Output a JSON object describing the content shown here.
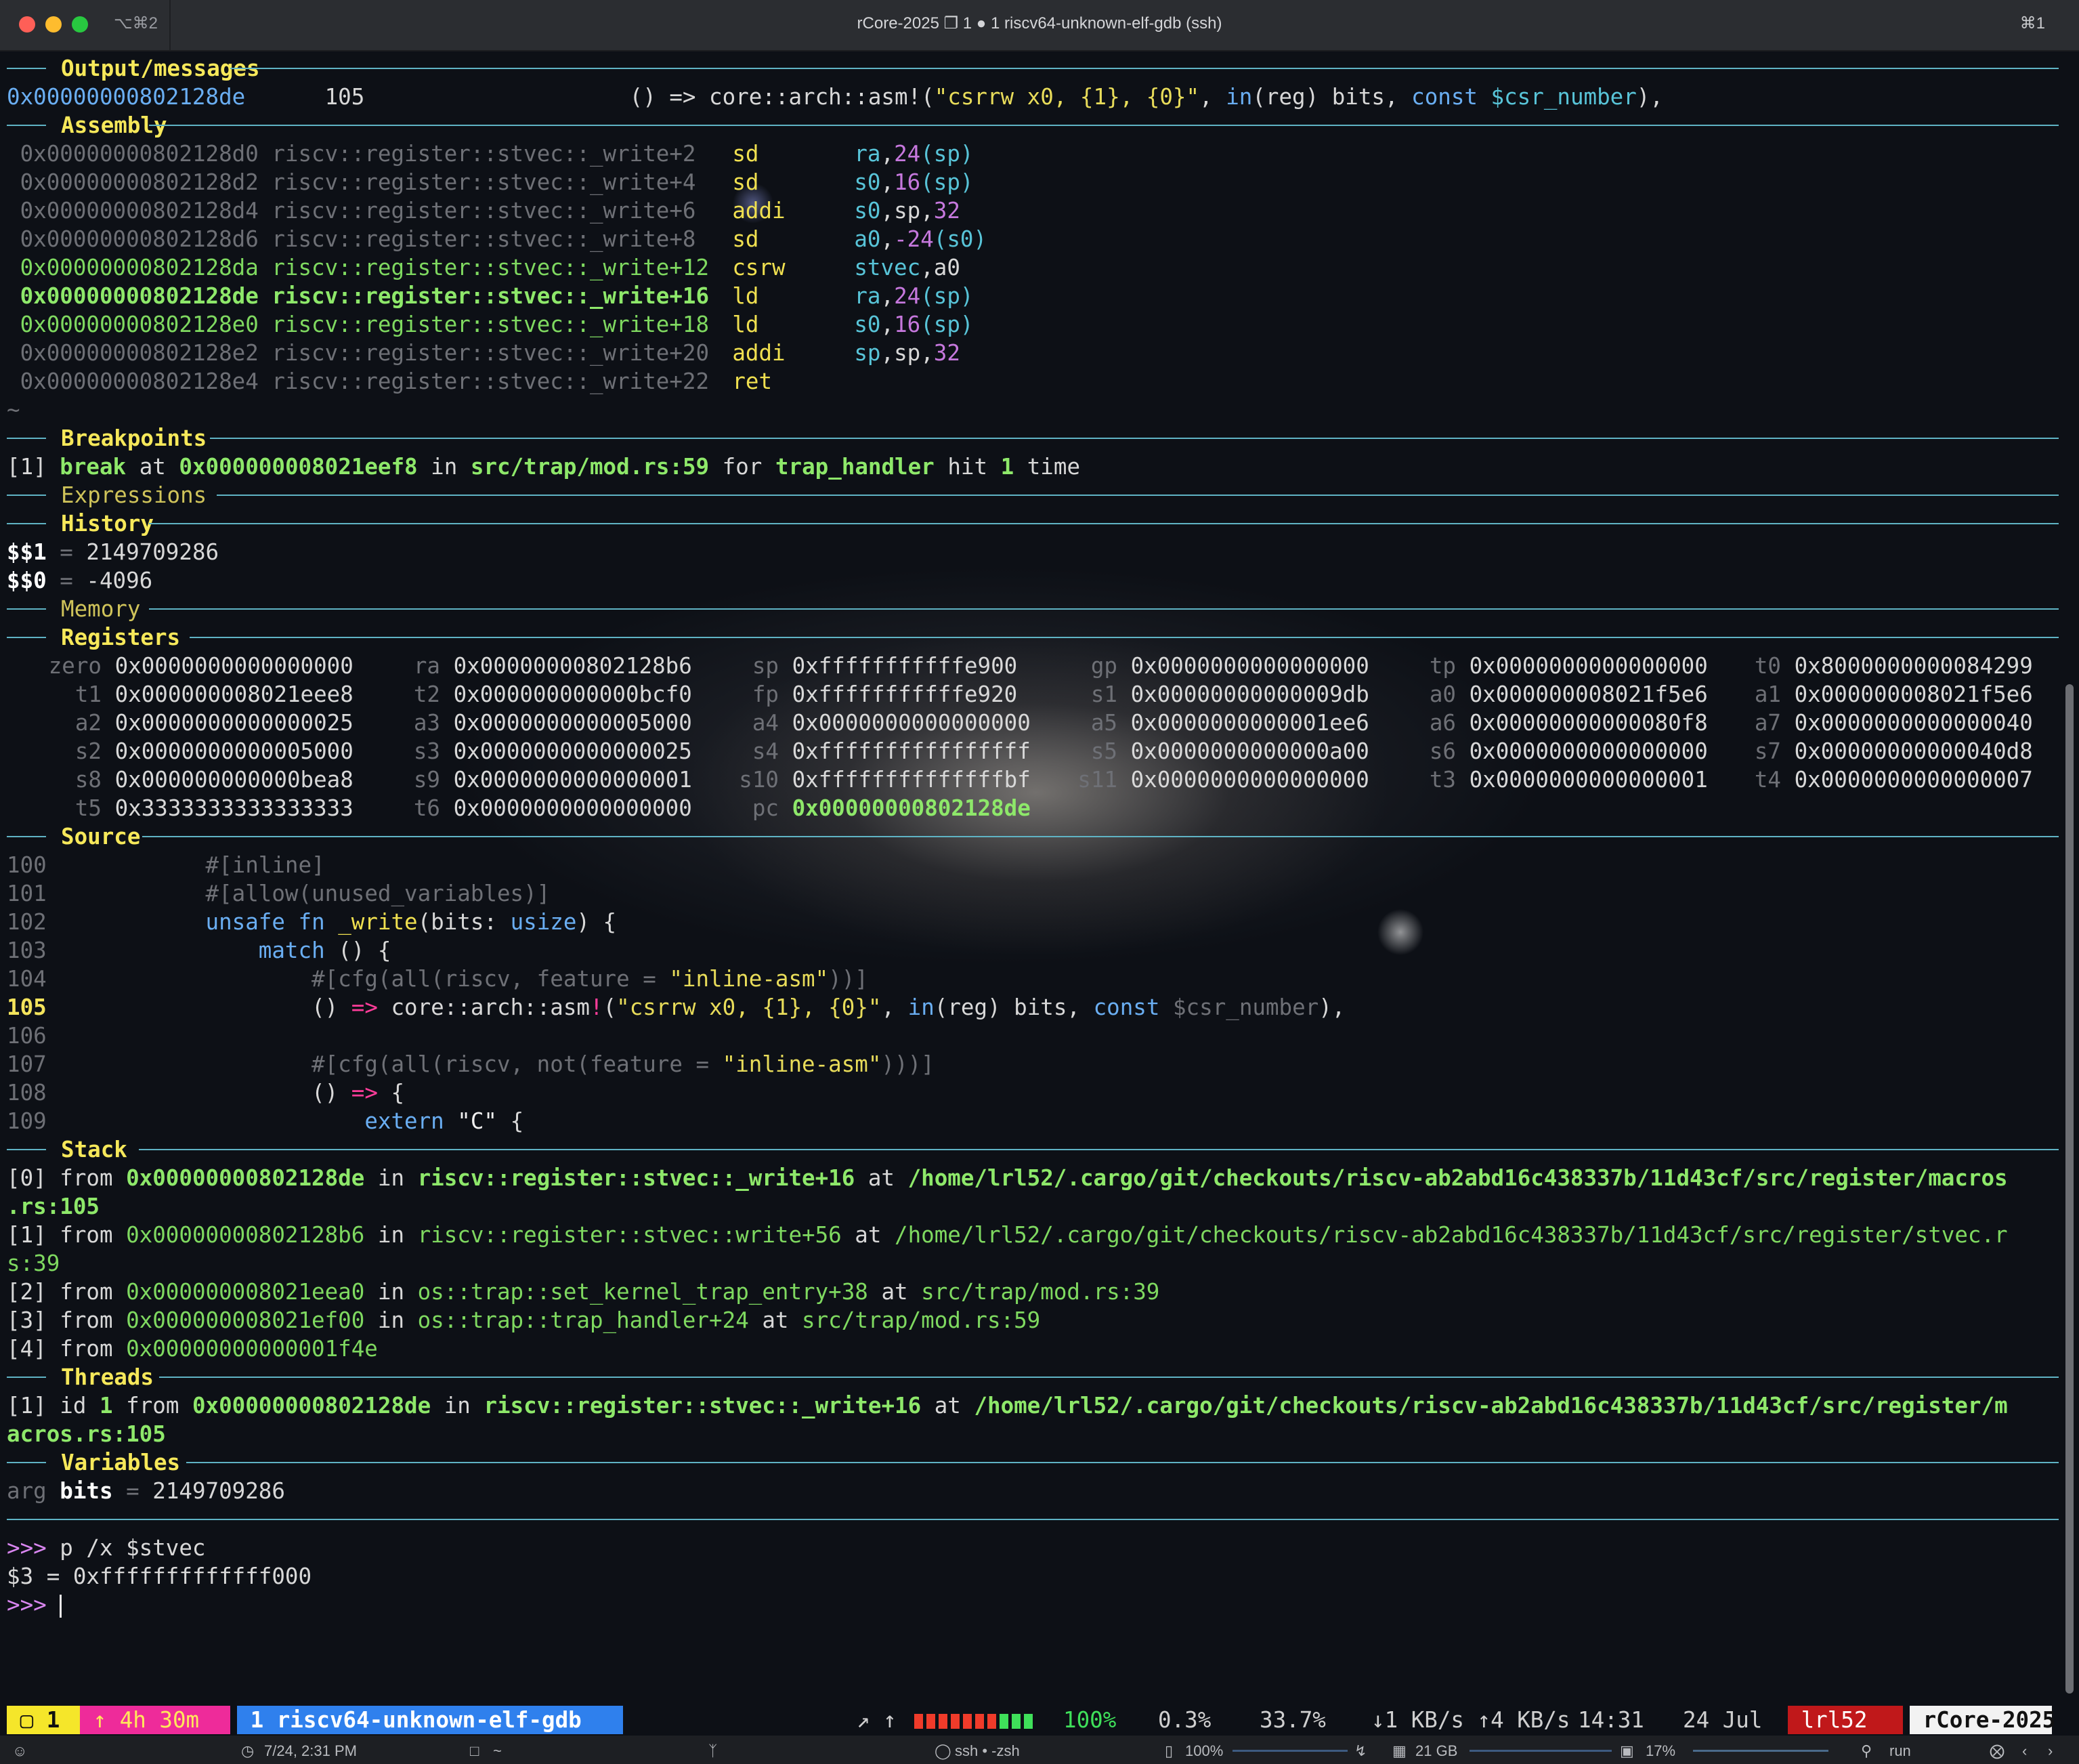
{
  "titlebar": {
    "shortcut_left": "⌥⌘2",
    "title": "rCore-2025 ❐ 1 ● 1 riscv64-unknown-elf-gdb (ssh)",
    "shortcut_right": "⌘1"
  },
  "output": {
    "title": "Output/messages",
    "address": "0x00000000802128de",
    "line_no": "105",
    "code_pre": "() => core::arch::asm!(",
    "code_str": "\"csrrw x0, {1}, {0}\"",
    "code_comma": ", ",
    "code_in": "in",
    "code_mid": "(reg) bits, ",
    "code_const": "const",
    "code_var": " $csr_number",
    "code_end": "),"
  },
  "assembly": {
    "title": "Assembly",
    "rows": [
      {
        "addr": "0x00000000802128d0",
        "sym": "riscv::register::stvec::_write+2",
        "op": "sd",
        "a1": "ra",
        "a2": ",",
        "a3": "24",
        "a4": "(sp)"
      },
      {
        "addr": "0x00000000802128d2",
        "sym": "riscv::register::stvec::_write+4",
        "op": "sd",
        "a1": "s0",
        "a2": ",",
        "a3": "16",
        "a4": "(sp)"
      },
      {
        "addr": "0x00000000802128d4",
        "sym": "riscv::register::stvec::_write+6",
        "op": "addi",
        "a1": "s0",
        "a2": ",sp,",
        "a3": "32",
        "a4": ""
      },
      {
        "addr": "0x00000000802128d6",
        "sym": "riscv::register::stvec::_write+8",
        "op": "sd",
        "a1": "a0",
        "a2": ",",
        "a3": "-24",
        "a4": "(s0)"
      },
      {
        "addr": "0x00000000802128da",
        "sym": "riscv::register::stvec::_write+12",
        "op": "csrw",
        "a1": "stvec",
        "a2": ",a0",
        "a3": "",
        "a4": ""
      },
      {
        "addr": "0x00000000802128de",
        "sym": "riscv::register::stvec::_write+16",
        "op": "ld",
        "a1": "ra",
        "a2": ",",
        "a3": "24",
        "a4": "(sp)"
      },
      {
        "addr": "0x00000000802128e0",
        "sym": "riscv::register::stvec::_write+18",
        "op": "ld",
        "a1": "s0",
        "a2": ",",
        "a3": "16",
        "a4": "(sp)"
      },
      {
        "addr": "0x00000000802128e2",
        "sym": "riscv::register::stvec::_write+20",
        "op": "addi",
        "a1": "sp",
        "a2": ",sp,",
        "a3": "32",
        "a4": ""
      },
      {
        "addr": "0x00000000802128e4",
        "sym": "riscv::register::stvec::_write+22",
        "op": "ret",
        "a1": "",
        "a2": "",
        "a3": "",
        "a4": ""
      }
    ],
    "tilde": "~"
  },
  "breakpoints": {
    "title": "Breakpoints",
    "index": "[1]",
    "kw_break": "break",
    "at": " at ",
    "addr": "0x000000008021eef8",
    "in": " in ",
    "file": "src/trap/mod.rs:59",
    "for": " for ",
    "func": "trap_handler",
    "hit": " hit ",
    "count": "1",
    "time": " time"
  },
  "expressions": {
    "title": "Expressions"
  },
  "history": {
    "title": "History",
    "rows": [
      {
        "name": "$$1",
        "eq": " = ",
        "value": "2149709286"
      },
      {
        "name": "$$0",
        "eq": " = ",
        "value": "-4096"
      }
    ]
  },
  "memory": {
    "title": "Memory"
  },
  "registers": {
    "title": "Registers",
    "rows": [
      [
        {
          "n": "zero",
          "v": "0x0000000000000000"
        },
        {
          "n": "ra",
          "v": "0x00000000802128b6"
        },
        {
          "n": "sp",
          "v": "0xfffffffffffe900"
        },
        {
          "n": "gp",
          "v": "0x0000000000000000"
        },
        {
          "n": "tp",
          "v": "0x0000000000000000"
        },
        {
          "n": "t0",
          "v": "0x8000000000084299"
        }
      ],
      [
        {
          "n": "t1",
          "v": "0x000000008021eee8"
        },
        {
          "n": "t2",
          "v": "0x000000000000bcf0"
        },
        {
          "n": "fp",
          "v": "0xfffffffffffe920"
        },
        {
          "n": "s1",
          "v": "0x00000000000009db"
        },
        {
          "n": "a0",
          "v": "0x000000008021f5e6"
        },
        {
          "n": "a1",
          "v": "0x000000008021f5e6"
        }
      ],
      [
        {
          "n": "a2",
          "v": "0x0000000000000025"
        },
        {
          "n": "a3",
          "v": "0x0000000000005000"
        },
        {
          "n": "a4",
          "v": "0x0000000000000000"
        },
        {
          "n": "a5",
          "v": "0x0000000000001ee6"
        },
        {
          "n": "a6",
          "v": "0x00000000000080f8"
        },
        {
          "n": "a7",
          "v": "0x0000000000000040"
        }
      ],
      [
        {
          "n": "s2",
          "v": "0x0000000000005000"
        },
        {
          "n": "s3",
          "v": "0x0000000000000025"
        },
        {
          "n": "s4",
          "v": "0xffffffffffffffff"
        },
        {
          "n": "s5",
          "v": "0x0000000000000a00"
        },
        {
          "n": "s6",
          "v": "0x0000000000000000"
        },
        {
          "n": "s7",
          "v": "0x00000000000040d8"
        }
      ],
      [
        {
          "n": "s8",
          "v": "0x000000000000bea8"
        },
        {
          "n": "s9",
          "v": "0x0000000000000001"
        },
        {
          "n": "s10",
          "v": "0xffffffffffffffbf"
        },
        {
          "n": "s11",
          "v": "0x0000000000000000"
        },
        {
          "n": "t3",
          "v": "0x0000000000000001"
        },
        {
          "n": "t4",
          "v": "0x0000000000000007"
        }
      ],
      [
        {
          "n": "t5",
          "v": "0x3333333333333333"
        },
        {
          "n": "t6",
          "v": "0x0000000000000000"
        },
        {
          "n": "pc",
          "v": "0x00000000802128de"
        }
      ]
    ]
  },
  "source": {
    "title": "Source",
    "l100": {
      "no": "100",
      "txt": "        #[inline]"
    },
    "l101": {
      "no": "101",
      "txt": "        #[allow(unused_variables)]"
    },
    "l102": {
      "no": "102",
      "ind": "        ",
      "kw": "unsafe fn",
      "fn": " _write",
      "a": "(bits: ",
      "ty": "usize",
      "b": ") {"
    },
    "l103": {
      "no": "103",
      "ind": "            ",
      "kw": "match",
      "rest": " () {"
    },
    "l104": {
      "no": "104",
      "a": "                #[cfg(all(riscv, feature = ",
      "s": "\"inline-asm\"",
      "b": "))]"
    },
    "l105": {
      "no": "105",
      "ind": "                ",
      "a": "() ",
      "arrow": "=>",
      "b": " core::arch::asm",
      "bang": "!",
      "c": "(",
      "s": "\"csrrw x0, {1}, {0}\"",
      "d": ", ",
      "in": "in",
      "e": "(reg) bits, ",
      "const": "const",
      "f": " $csr_number",
      "g": "),"
    },
    "l106": {
      "no": "106"
    },
    "l107": {
      "no": "107",
      "a": "                #[cfg(all(riscv, not(feature = ",
      "s": "\"inline-asm\"",
      "b": ")))]"
    },
    "l108": {
      "no": "108",
      "ind": "                ",
      "a": "() ",
      "arrow": "=>",
      "b": " {"
    },
    "l109": {
      "no": "109",
      "ind": "                    ",
      "kw": "extern",
      "s": " \"C\"",
      "b": " {"
    }
  },
  "stack": {
    "title": "Stack",
    "f0": {
      "i": "[0]",
      "from": " from ",
      "addr": "0x00000000802128de",
      "in": " in ",
      "fn": "riscv::register::stvec::_write+16",
      "at": " at ",
      "path": "/home/lrl52/.cargo/git/checkouts/riscv-ab2abd16c438337b/11d43cf/src/register/macros",
      "path2": ".rs:105"
    },
    "f1": {
      "i": "[1]",
      "from": " from ",
      "addr": "0x00000000802128b6",
      "in": " in ",
      "fn": "riscv::register::stvec::write+56",
      "at": " at ",
      "path": "/home/lrl52/.cargo/git/checkouts/riscv-ab2abd16c438337b/11d43cf/src/register/stvec.r",
      "path2": "s:39"
    },
    "f2": {
      "i": "[2]",
      "from": " from ",
      "addr": "0x000000008021eea0",
      "in": " in ",
      "fn": "os::trap::set_kernel_trap_entry+38",
      "at": " at ",
      "path": "src/trap/mod.rs:39"
    },
    "f3": {
      "i": "[3]",
      "from": " from ",
      "addr": "0x000000008021ef00",
      "in": " in ",
      "fn": "os::trap::trap_handler+24",
      "at": " at ",
      "path": "src/trap/mod.rs:59"
    },
    "f4": {
      "i": "[4]",
      "from": " from ",
      "addr": "0x00000000000001f4e"
    }
  },
  "threads": {
    "title": "Threads",
    "i": "[1]",
    "id": " id ",
    "idn": "1",
    "from": " from ",
    "addr": "0x00000000802128de",
    "in": " in ",
    "fn": "riscv::register::stvec::_write+16",
    "at": " at ",
    "path": "/home/lrl52/.cargo/git/checkouts/riscv-ab2abd16c438337b/11d43cf/src/register/m",
    "path2": "acros.rs:105"
  },
  "variables": {
    "title": "Variables",
    "kind": "arg",
    "name": "bits",
    "eq": " = ",
    "value": "2149709286"
  },
  "console": {
    "prompt": ">>>",
    "cmd1": " p /x $stvec",
    "result": "$3 = 0xfffffffffffff000"
  },
  "tmux": {
    "win_idx": " ▢ 1 ",
    "uptime": " ↑ 4h 30m ",
    "window": " 1 riscv64-unknown-elf-gdb ",
    "arrows": "↗ ↑ ",
    "battery": "100%",
    "cpu": "0.3%",
    "mem": "33.7%",
    "net": "↓1 KB/s ↑4 KB/s",
    "time": "14:31",
    "date": "24 Jul",
    "user": " lrl52 ",
    "session": " rCore-2025 ",
    "battery_color": "#ef3b2a"
  },
  "macbar": {
    "date": "7/24, 2:31 PM",
    "folder": "~",
    "shell": "ssh • -zsh",
    "battery": "100%",
    "mem": "21 GB",
    "cpu": "17%",
    "search": "run"
  }
}
